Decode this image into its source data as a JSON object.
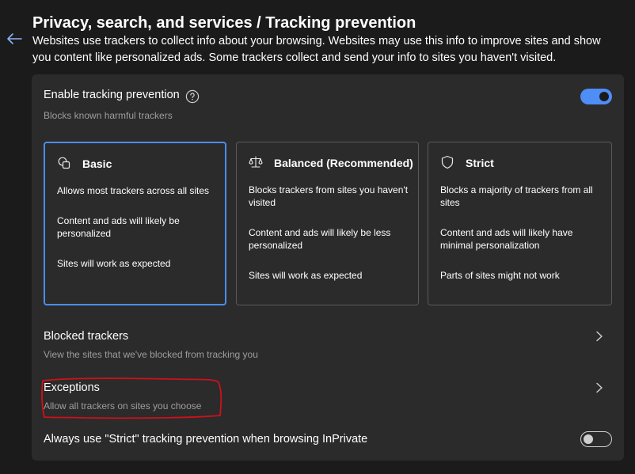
{
  "header": {
    "title": "Privacy, search, and services / Tracking prevention",
    "description": "Websites use trackers to collect info about your browsing. Websites may use this info to improve sites and show you content like personalized ads. Some trackers collect and send your info to sites you haven't visited."
  },
  "tracking": {
    "title": "Enable tracking prevention",
    "subtitle": "Blocks known harmful trackers",
    "enabled": true
  },
  "levels": [
    {
      "title": "Basic",
      "icon": "basic-shapes-icon",
      "selected": true,
      "lines": [
        "Allows most trackers across all sites",
        "Content and ads will likely be personalized",
        "Sites will work as expected"
      ]
    },
    {
      "title": "Balanced (Recommended)",
      "icon": "scales-icon",
      "selected": false,
      "lines": [
        "Blocks trackers from sites you haven't visited",
        "Content and ads will likely be less personalized",
        "Sites will work as expected"
      ]
    },
    {
      "title": "Strict",
      "icon": "shield-icon",
      "selected": false,
      "lines": [
        "Blocks a majority of trackers from all sites",
        "Content and ads will likely have minimal personalization",
        "Parts of sites might not work"
      ]
    }
  ],
  "blocked": {
    "title": "Blocked trackers",
    "subtitle": "View the sites that we've blocked from tracking you"
  },
  "exceptions": {
    "title": "Exceptions",
    "subtitle": "Allow all trackers on sites you choose"
  },
  "inprivate": {
    "title": "Always use \"Strict\" tracking prevention when browsing InPrivate",
    "enabled": false
  },
  "colors": {
    "background": "#1b1b1b",
    "panel": "#2b2b2b",
    "accent": "#4f8df7",
    "annotation": "#d0101a"
  }
}
